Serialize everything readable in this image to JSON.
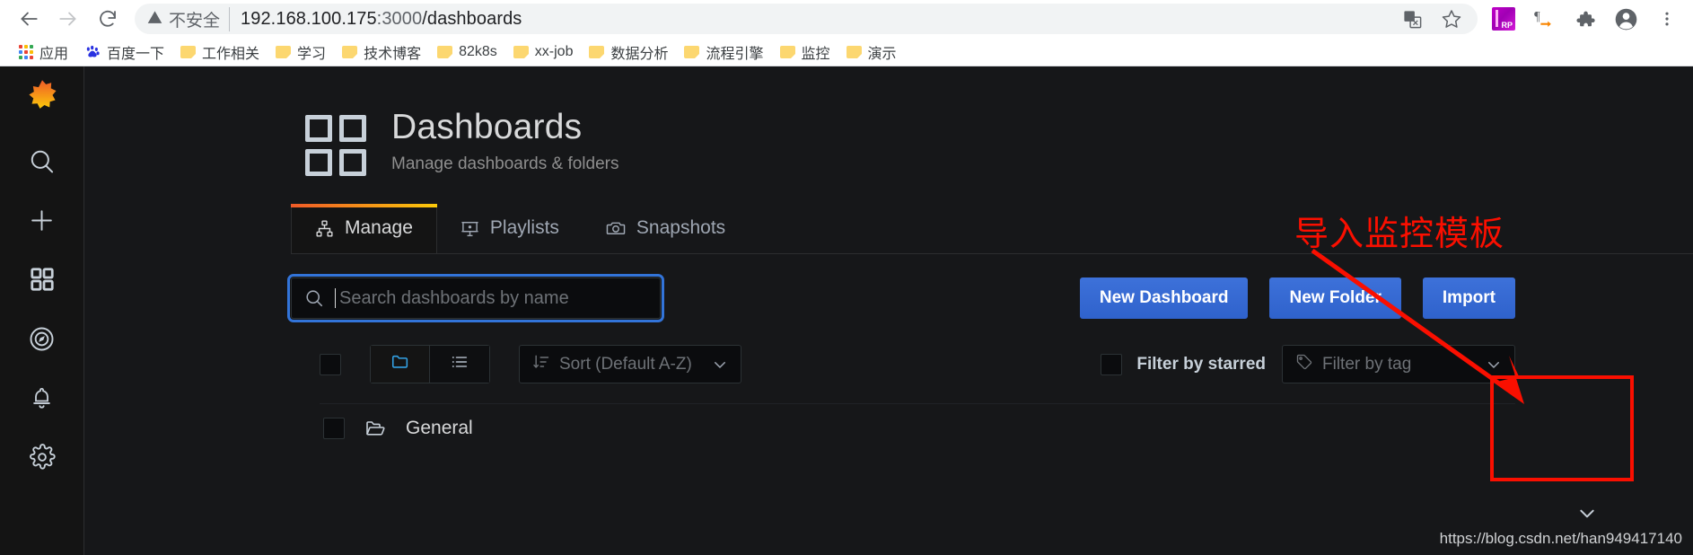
{
  "browser": {
    "back_icon": "back-arrow-icon",
    "forward_icon": "forward-arrow-icon",
    "reload_icon": "reload-icon",
    "security_warning": "不安全",
    "security_icon": "warning-triangle-icon",
    "url_host": "192.168.100.175",
    "url_port": ":3000",
    "url_path": "/dashboards",
    "translate_icon": "translate-icon",
    "bookmark_star_icon": "star-icon",
    "extension_rp_label": "RP",
    "extension_pilcrow_icon": "pilcrow-arrow-icon",
    "extension_puzzle_icon": "puzzle-piece-icon",
    "profile_icon": "profile-avatar-icon",
    "menu_icon": "three-dot-menu-icon",
    "bookmarks": [
      {
        "label": "应用",
        "icon": "apps-grid-icon"
      },
      {
        "label": "百度一下",
        "icon": "baidu-icon"
      },
      {
        "label": "工作相关",
        "icon": "folder-icon"
      },
      {
        "label": "学习",
        "icon": "folder-icon"
      },
      {
        "label": "技术博客",
        "icon": "folder-icon"
      },
      {
        "label": "82k8s",
        "icon": "folder-icon"
      },
      {
        "label": "xx-job",
        "icon": "folder-icon"
      },
      {
        "label": "数据分析",
        "icon": "folder-icon"
      },
      {
        "label": "流程引擎",
        "icon": "folder-icon"
      },
      {
        "label": "监控",
        "icon": "folder-icon"
      },
      {
        "label": "演示",
        "icon": "folder-icon"
      }
    ]
  },
  "sidebar": {
    "logo": "grafana-logo-icon",
    "items": [
      {
        "name": "search",
        "icon": "search-icon"
      },
      {
        "name": "create",
        "icon": "plus-icon"
      },
      {
        "name": "dashboards",
        "icon": "dashboards-grid-icon"
      },
      {
        "name": "explore",
        "icon": "compass-icon"
      },
      {
        "name": "alerting",
        "icon": "bell-icon"
      },
      {
        "name": "configuration",
        "icon": "gear-icon"
      }
    ]
  },
  "page": {
    "icon": "dashboards-grid-icon",
    "title": "Dashboards",
    "subtitle": "Manage dashboards & folders"
  },
  "tabs": [
    {
      "label": "Manage",
      "icon": "sitemap-icon",
      "active": true
    },
    {
      "label": "Playlists",
      "icon": "presentation-icon",
      "active": false
    },
    {
      "label": "Snapshots",
      "icon": "camera-icon",
      "active": false
    }
  ],
  "search": {
    "icon": "search-icon",
    "placeholder": "Search dashboards by name",
    "value": ""
  },
  "actions": {
    "new_dashboard": "New Dashboard",
    "new_folder": "New Folder",
    "import": "Import"
  },
  "filters": {
    "select_all_checkbox": "",
    "view_folders_icon": "folder-icon",
    "view_list_icon": "list-icon",
    "sort": {
      "icon": "sort-amount-down-icon",
      "label": "Sort (Default A-Z)",
      "chevron": "chevron-down-icon"
    },
    "filter_starred_label": "Filter by starred",
    "tag": {
      "icon": "tag-icon",
      "placeholder": "Filter by tag",
      "chevron": "chevron-down-icon"
    }
  },
  "folders": [
    {
      "name": "General",
      "icon": "folder-open-icon"
    }
  ],
  "annotation": {
    "text": "导入监控模板",
    "color": "#fa0f00",
    "arrow": "red-arrow-pointing-to-import-button",
    "highlight": "red-box-around-import-button"
  },
  "watermark": {
    "text": "https://blog.csdn.net/han949417140",
    "scroll_chevron": "chevron-down-icon"
  },
  "colors": {
    "accent_blue": "#3274d9",
    "annotation_red": "#fa0f00",
    "tab_active_gradient_start": "#f05a28",
    "tab_active_gradient_end": "#fbca0a",
    "app_bg": "#161719",
    "panel_bg": "#141414"
  }
}
